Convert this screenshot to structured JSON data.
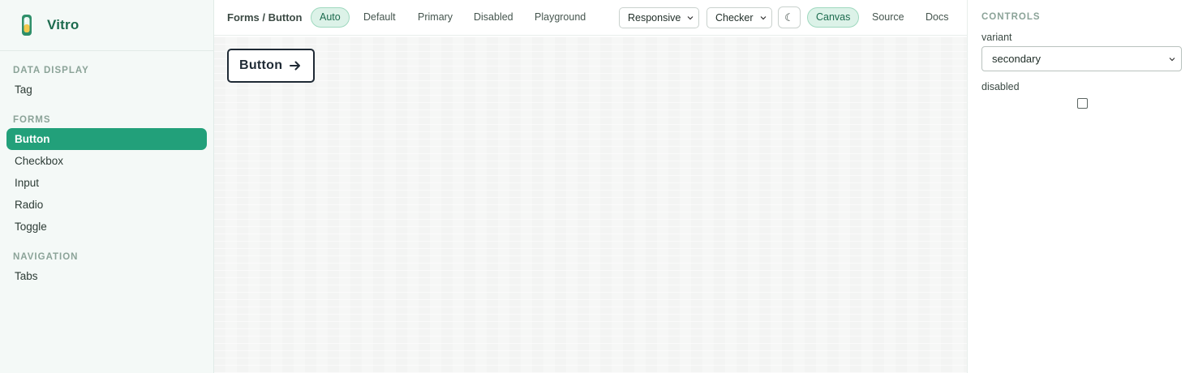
{
  "app": {
    "name": "Vitro"
  },
  "sidebar": {
    "sections": [
      {
        "title": "DATA DISPLAY",
        "items": [
          "Tag"
        ]
      },
      {
        "title": "FORMS",
        "items": [
          "Button",
          "Checkbox",
          "Input",
          "Radio",
          "Toggle"
        ]
      },
      {
        "title": "NAVIGATION",
        "items": [
          "Tabs"
        ]
      }
    ],
    "active_item": "Button"
  },
  "toolbar": {
    "breadcrumb": "Forms / Button",
    "story_tabs": [
      "Auto",
      "Default",
      "Primary",
      "Disabled",
      "Playground"
    ],
    "active_story_tab": "Auto",
    "viewport_select": "Responsive",
    "background_select": "Checker",
    "theme_toggle_glyph": "☾",
    "view_tabs": [
      "Canvas",
      "Source",
      "Docs"
    ],
    "active_view_tab": "Canvas"
  },
  "canvas": {
    "demo_button": {
      "label": "Button",
      "icon": "arrow-right-icon"
    }
  },
  "controls": {
    "title": "CONTROLS",
    "variant": {
      "label": "variant",
      "value": "secondary"
    },
    "disabled": {
      "label": "disabled",
      "checked": false
    }
  },
  "colors": {
    "accent": "#22a07a",
    "brand_text": "#1c6b4e",
    "active_pill_bg": "#dcf2e8",
    "sidebar_bg": "#f4f9f7"
  }
}
